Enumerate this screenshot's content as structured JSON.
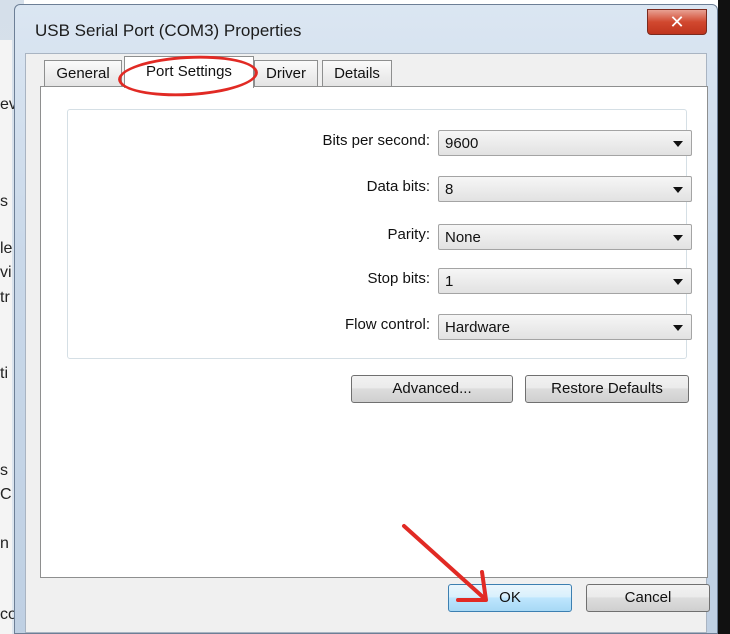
{
  "background_window": {
    "fragments": [
      "ev",
      "s",
      "le",
      "vi",
      "tr",
      "ti",
      "s",
      "C",
      "n",
      "co"
    ]
  },
  "dialog": {
    "title": "USB Serial Port (COM3) Properties",
    "close_glyph": "✕",
    "tabs": [
      {
        "label": "General",
        "active": false
      },
      {
        "label": "Port Settings",
        "active": true
      },
      {
        "label": "Driver",
        "active": false
      },
      {
        "label": "Details",
        "active": false
      }
    ],
    "settings": [
      {
        "label": "Bits per second:",
        "value": "9600"
      },
      {
        "label": "Data bits:",
        "value": "8"
      },
      {
        "label": "Parity:",
        "value": "None"
      },
      {
        "label": "Stop bits:",
        "value": "1"
      },
      {
        "label": "Flow control:",
        "value": "Hardware"
      }
    ],
    "buttons": {
      "advanced": "Advanced...",
      "restore_defaults": "Restore Defaults",
      "ok": "OK",
      "cancel": "Cancel"
    }
  },
  "annotations": {
    "color": "#e12a24",
    "circled_item": "Port Settings",
    "arrow_target": "OK"
  }
}
